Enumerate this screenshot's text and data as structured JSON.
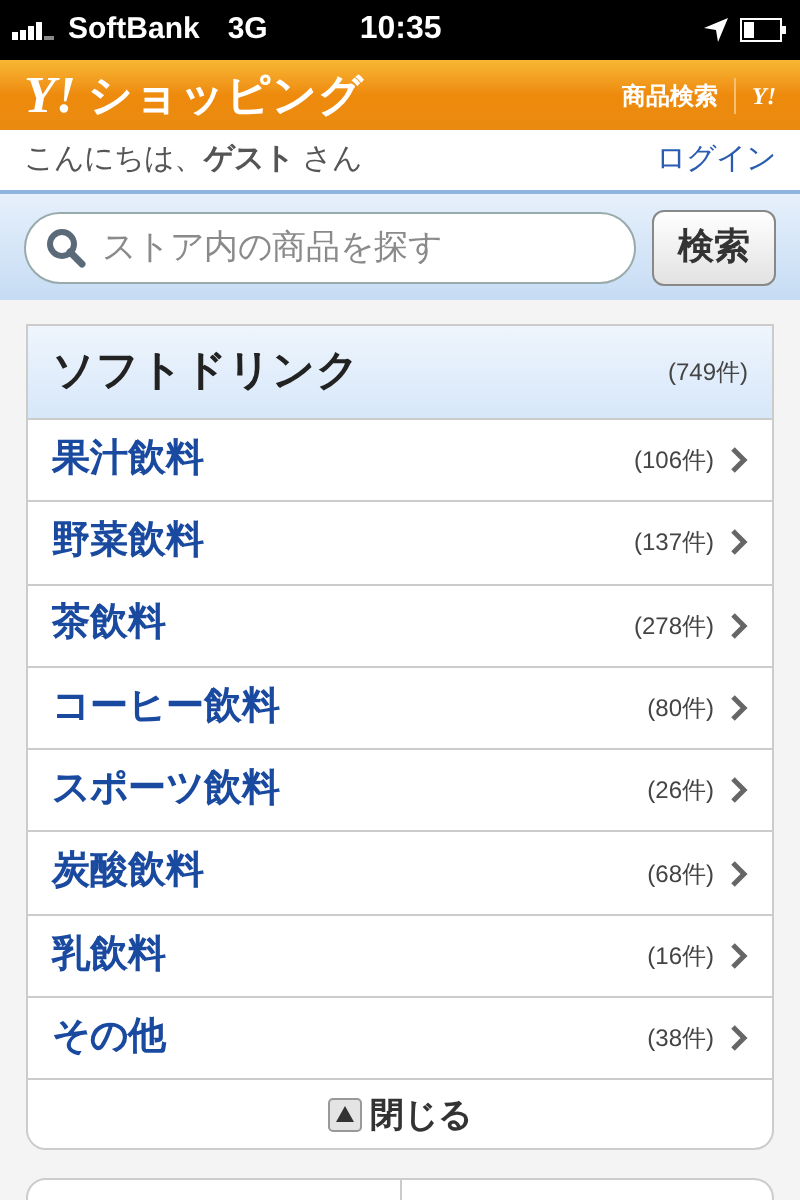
{
  "status_bar": {
    "carrier": "SoftBank",
    "network": "3G",
    "time": "10:35"
  },
  "header": {
    "logo": "Y!",
    "title": "ショッピング",
    "link": "商品検索",
    "small_logo": "Y!"
  },
  "greeting": {
    "text": "こんにちは、**ゲスト** さん",
    "login": "ログイン"
  },
  "search": {
    "placeholder": "ストア内の商品を探す",
    "button": "検索"
  },
  "category": {
    "title": "ソフトドリンク",
    "count": "(749件)",
    "items": [
      {
        "label": "果汁飲料",
        "count": "(106件)"
      },
      {
        "label": "野菜飲料",
        "count": "(137件)"
      },
      {
        "label": "茶飲料",
        "count": "(278件)"
      },
      {
        "label": "コーヒー飲料",
        "count": "(80件)"
      },
      {
        "label": "スポーツ飲料",
        "count": "(26件)"
      },
      {
        "label": "炭酸飲料",
        "count": "(68件)"
      },
      {
        "label": "乳飲料",
        "count": "(16件)"
      },
      {
        "label": "その他",
        "count": "(38件)"
      }
    ],
    "close": "閉じる"
  }
}
